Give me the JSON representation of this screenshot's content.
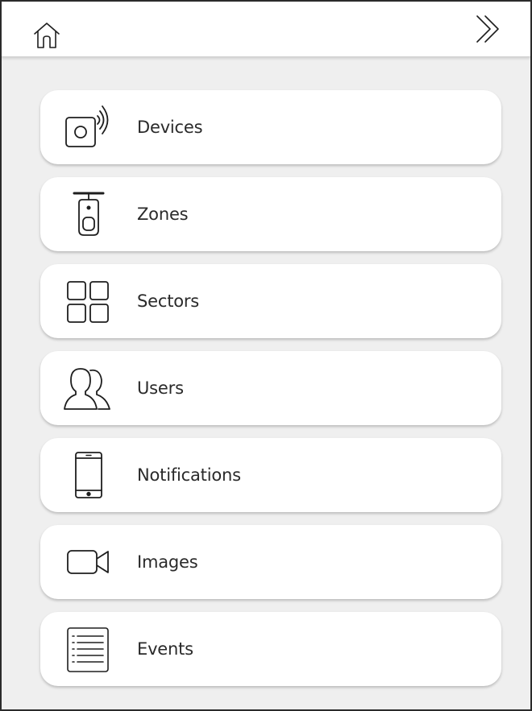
{
  "topbar": {
    "home_icon": "home-icon",
    "forward_icon": "double-chevron-right-icon"
  },
  "menu": {
    "items": [
      {
        "label": "Devices",
        "icon": "device-signal-icon"
      },
      {
        "label": "Zones",
        "icon": "motion-sensor-icon"
      },
      {
        "label": "Sectors",
        "icon": "grid-icon"
      },
      {
        "label": "Users",
        "icon": "users-icon"
      },
      {
        "label": "Notifications",
        "icon": "smartphone-icon"
      },
      {
        "label": "Images",
        "icon": "video-camera-icon"
      },
      {
        "label": "Events",
        "icon": "list-icon"
      }
    ]
  },
  "colors": {
    "background": "#efefef",
    "card": "#ffffff",
    "text": "#2a2a2a",
    "icon_stroke": "#1e1e1e"
  }
}
